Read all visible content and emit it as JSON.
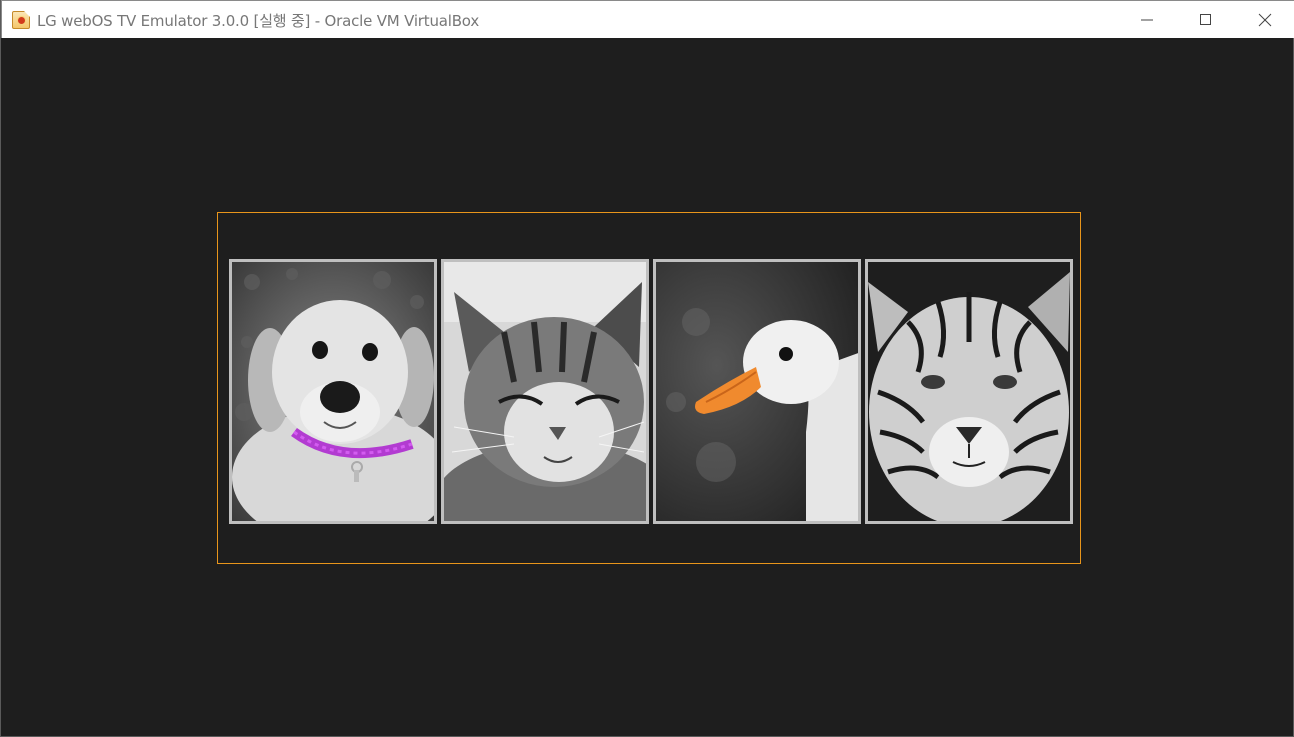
{
  "window": {
    "title": "LG webOS TV Emulator 3.0.0 [실행 중] - Oracle VM VirtualBox",
    "app_icon": "virtualbox-icon",
    "controls": [
      "minimize-icon",
      "maximize-icon",
      "close-icon"
    ]
  },
  "gallery": {
    "highlight_color": "#e8951b",
    "photos": [
      {
        "subject": "puppy",
        "accent": "purple collar"
      },
      {
        "subject": "cat",
        "accent": "none"
      },
      {
        "subject": "duck",
        "accent": "orange beak"
      },
      {
        "subject": "tiger",
        "accent": "none"
      }
    ]
  }
}
